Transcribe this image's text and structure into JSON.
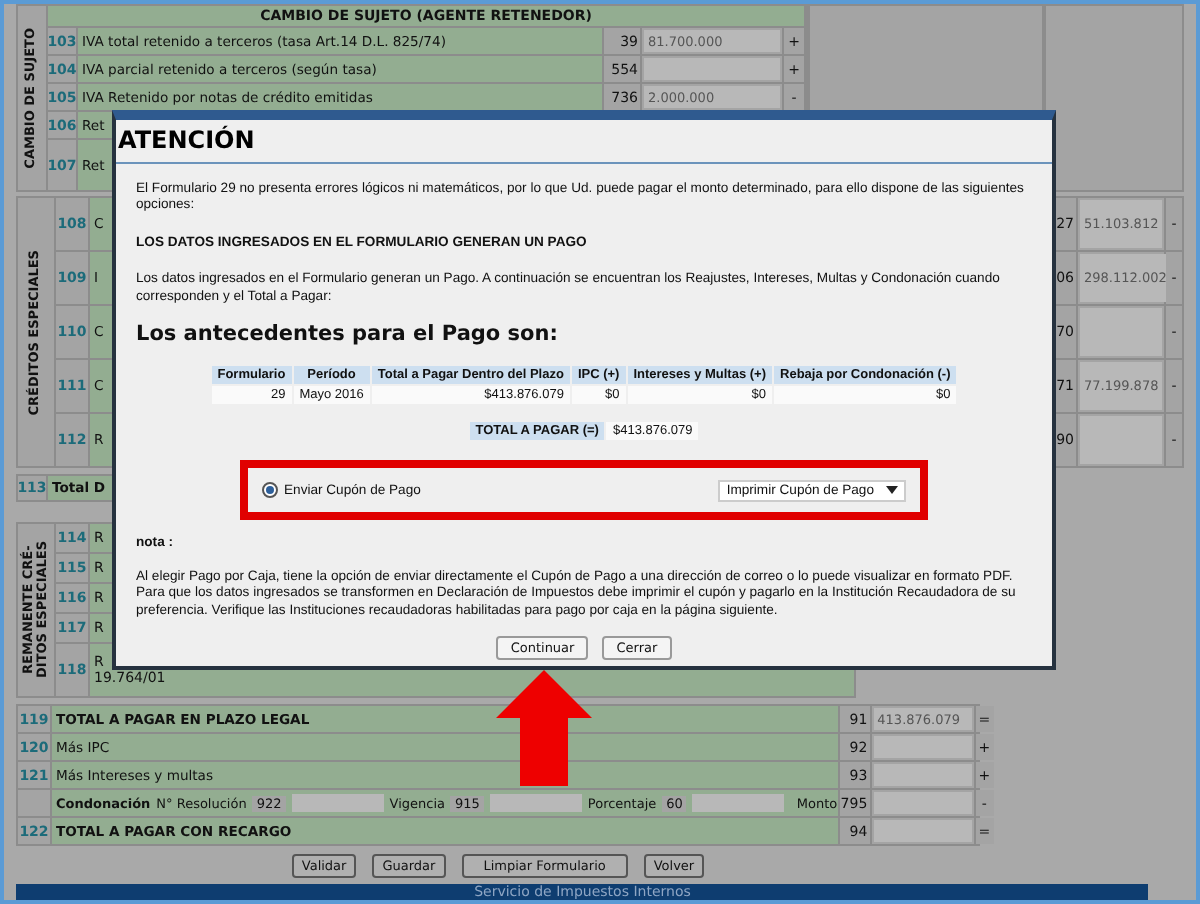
{
  "form_top": {
    "side_label": "CAMBIO DE SUJETO",
    "header": "CAMBIO DE SUJETO (AGENTE RETENEDOR)",
    "rows": [
      {
        "number": "103",
        "label": "IVA total retenido a terceros (tasa Art.14 D.L. 825/74)",
        "code": "39",
        "value": "81.700.000",
        "sign": "+"
      },
      {
        "number": "104",
        "label": "IVA parcial retenido a terceros (según tasa)",
        "code": "554",
        "sign": "+"
      },
      {
        "number": "105",
        "label": "IVA Retenido por notas de crédito emitidas",
        "code": "736",
        "value": "2.000.000",
        "sign": "-"
      },
      {
        "number": "106",
        "label": "Ret"
      },
      {
        "number": "107",
        "label": "Ret"
      }
    ]
  },
  "creditos": {
    "side_label": "CRÉDITOS ESPECIALES",
    "rows": [
      {
        "number": "108",
        "label": "C",
        "code": "27",
        "value": "51.103.812",
        "sign": "-"
      },
      {
        "number": "109",
        "label": "I",
        "code": "06",
        "value": "298.112.002",
        "sign": "-"
      },
      {
        "number": "110",
        "label": "C",
        "code": "70",
        "sign": "-"
      },
      {
        "number": "111",
        "label": "C",
        "code": "71",
        "value": "77.199.878",
        "sign": "-"
      },
      {
        "number": "112",
        "label": "R",
        "code": "90",
        "sign": "-"
      }
    ]
  },
  "total_row": {
    "number": "113",
    "label": "Total D"
  },
  "remanente": {
    "side_label": "REMANENTE CRÉ-DITOS ESPECIALES",
    "rows": [
      {
        "number": "114",
        "label": "R"
      },
      {
        "number": "115",
        "label": "R"
      },
      {
        "number": "116",
        "label": "R"
      },
      {
        "number": "117",
        "label": "R"
      },
      {
        "number": "118",
        "label": "R",
        "note": "19.764/01"
      }
    ]
  },
  "totals": {
    "rows": [
      {
        "kind": "total",
        "number": "119",
        "label": "TOTAL A PAGAR EN PLAZO LEGAL",
        "code": "91",
        "value": "413.876.079",
        "sign": "="
      },
      {
        "kind": "line",
        "number": "120",
        "label": "Más IPC",
        "code": "92",
        "sign": "+"
      },
      {
        "kind": "line",
        "number": "121",
        "label": "Más Intereses y multas",
        "code": "93",
        "sign": "+"
      }
    ],
    "condonacion": {
      "label": "Condonación",
      "fields": [
        {
          "label": "N° Resolución",
          "code": "922"
        },
        {
          "label": "Vigencia",
          "code": "915"
        },
        {
          "label": "Porcentaje",
          "code": "60"
        }
      ],
      "amount_label": "Monto",
      "amount_code": "795",
      "sign": "-"
    },
    "final": {
      "kind": "total",
      "number": "122",
      "label": "TOTAL A PAGAR CON RECARGO",
      "code": "94",
      "sign": "="
    }
  },
  "buttons": [
    "Validar",
    "Guardar",
    "Limpiar Formulario",
    "Volver"
  ],
  "footer": "Servicio de Impuestos Internos",
  "dialog": {
    "title": "ATENCIÓN",
    "intro": "El Formulario 29 no presenta errores lógicos ni matemáticos, por lo que Ud. puede pagar el monto determinado, para ello dispone de las siguientes opciones:",
    "heading": "LOS DATOS INGRESADOS EN EL FORMULARIO GENERAN UN PAGO",
    "description": "Los datos ingresados en el Formulario generan un Pago. A continuación se encuentran los Reajustes, Intereses, Multas y Condonación cuando corresponden y el Total a Pagar:",
    "subtitle": "Los antecedentes para el Pago son:",
    "table": {
      "columns": [
        "Formulario",
        "Período",
        "Total a Pagar Dentro del Plazo",
        "IPC (+)",
        "Intereses y Multas (+)",
        "Rebaja por Condonación (-)"
      ],
      "rows": [
        [
          "29",
          "Mayo 2016",
          "$413.876.079",
          "$0",
          "$0",
          "$0"
        ]
      ]
    },
    "total": {
      "label": "TOTAL A PAGAR (=)",
      "value": "$413.876.079"
    },
    "payment": {
      "radio": {
        "label": "Enviar Cupón de Pago",
        "selected": true
      },
      "select": "Imprimir Cupón de Pago"
    },
    "note_label": "nota :",
    "note": "Al elegir Pago por Caja, tiene la opción de enviar directamente el Cupón de Pago a una dirección de correo o lo puede visualizar en formato PDF. Para que los datos ingresados se transformen en Declaración de Impuestos debe imprimir el cupón y pagarlo en la Institución Recaudadora de su preferencia. Verifique las Instituciones recaudadoras habilitadas para pago por caja en la página siguiente.",
    "buttons": [
      "Continuar",
      "Cerrar"
    ]
  }
}
